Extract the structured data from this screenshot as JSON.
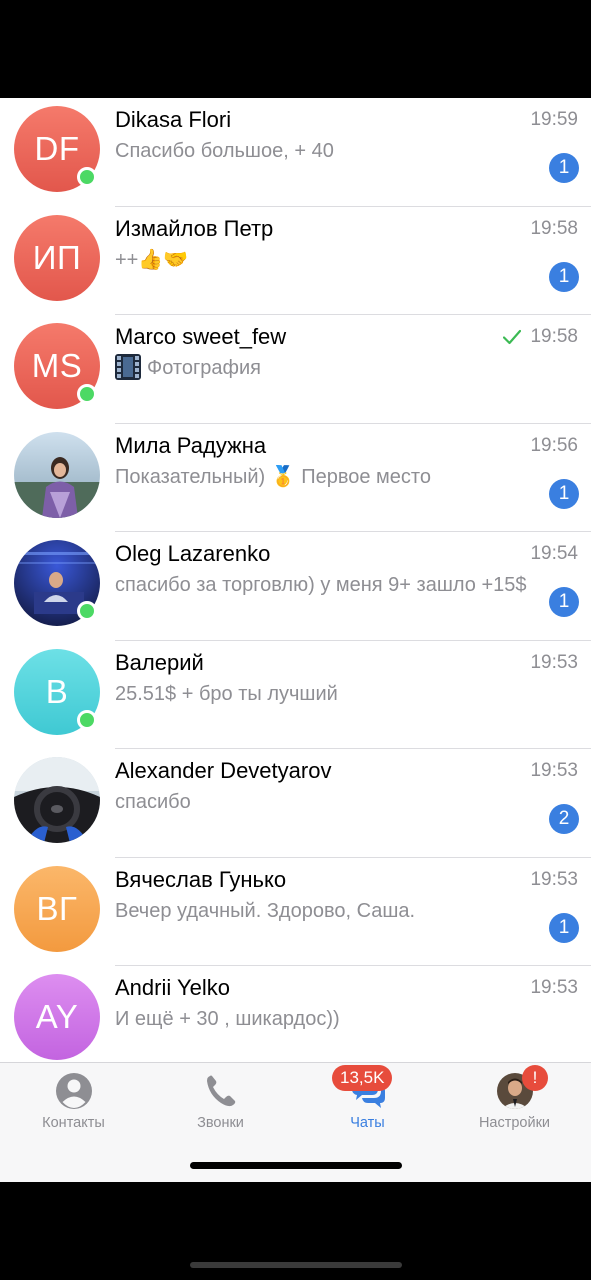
{
  "chats": [
    {
      "name": "Dikasa Flori",
      "preview": "Спасибо большое, + 40",
      "time": "19:59",
      "unread": "1",
      "initials": "DF",
      "color_top": "#f57a6b",
      "color_bottom": "#e2574c",
      "online": true
    },
    {
      "name": "Измайлов Петр",
      "preview": "++👍🤝",
      "time": "19:58",
      "unread": "1",
      "initials": "ИП",
      "color_top": "#f57a6b",
      "color_bottom": "#e2574c",
      "online": false
    },
    {
      "name": "Marco sweet_few",
      "preview": "Фотография",
      "time": "19:58",
      "read": true,
      "initials": "MS",
      "color_top": "#f57a6b",
      "color_bottom": "#e2574c",
      "online": true
    },
    {
      "name": "Мила Радужна",
      "preview": "Показательный)  🥇 Первое место",
      "time": "19:56",
      "unread": "1",
      "avatar_icon": "photo-avatar",
      "online": false
    },
    {
      "name": "Oleg Lazarenko",
      "preview": "спасибо за торговлю) у меня 9+ зашло +15$",
      "time": "19:54",
      "unread": "1",
      "avatar_icon": "photo-avatar",
      "online": true
    },
    {
      "name": "Валерий",
      "preview": "25.51$ + бро ты лучший",
      "time": "19:53",
      "initials": "В",
      "color_top": "#6de0e6",
      "color_bottom": "#3fc9d3",
      "online": true
    },
    {
      "name": "Alexander Devetyarov",
      "preview": "спасибо",
      "time": "19:53",
      "unread": "2",
      "avatar_icon": "photo-avatar",
      "online": false
    },
    {
      "name": "Вячеслав Гунько",
      "preview": "Вечер удачный. Здорово, Саша.",
      "time": "19:53",
      "unread": "1",
      "initials": "ВГ",
      "color_top": "#fbb76a",
      "color_bottom": "#f39a3f",
      "online": false
    },
    {
      "name": "Andrii Yelko",
      "preview": "И ещё + 30 , шикардос))",
      "time": "19:53",
      "initials": "AY",
      "color_top": "#dd8ef0",
      "color_bottom": "#c364e0",
      "online": false
    }
  ],
  "tabs": [
    {
      "label": "Контакты",
      "icon": "contacts-icon"
    },
    {
      "label": "Звонки",
      "icon": "phone-icon"
    },
    {
      "label": "Чаты",
      "icon": "chats-icon",
      "badge": "13,5K",
      "active": true
    },
    {
      "label": "Настройки",
      "icon": "settings-avatar-icon",
      "badge": "!"
    }
  ],
  "colors": {
    "accent": "#3a7fe0",
    "online": "#4cd964",
    "badge_red": "#e74c3c",
    "muted": "#8e8e93"
  }
}
